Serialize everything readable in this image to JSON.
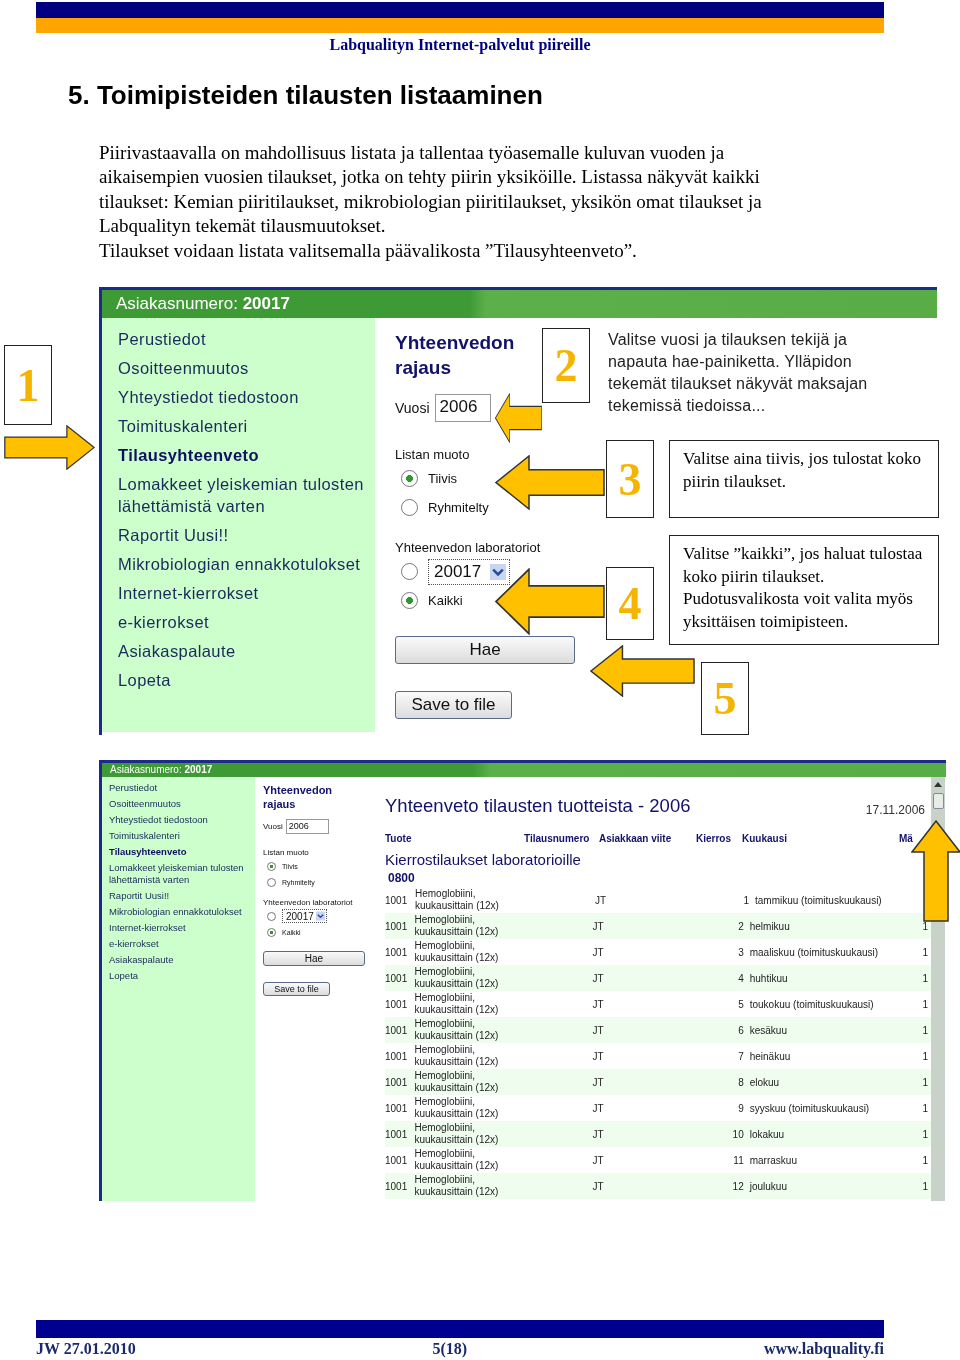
{
  "header": {
    "title": "Labqualityn Internet-palvelut piireille"
  },
  "heading": "5. Toimipisteiden tilausten listaaminen",
  "intro": [
    "Piirivastaavalla on mahdollisuus listata ja tallentaa työasemalle kuluvan vuoden ja aikaisempien vuosien tilaukset, jotka on tehty piirin yksiköille. Listassa näkyvät kaikki tilaukset: Kemian piiritilaukset, mikrobiologian piiritilaukset, yksikön omat tilaukset ja Labqualityn tekemät tilausmuutokset.",
    "Tilaukset voidaan listata valitsemalla päävalikosta ”Tilausyhteenveto”."
  ],
  "screenshot_1": {
    "customer_label": "Asiakasnumero:",
    "customer_number": "20017",
    "menu": [
      {
        "label": "Perustiedot",
        "selected": false
      },
      {
        "label": "Osoitteenmuutos",
        "selected": false
      },
      {
        "label": "Yhteystiedot tiedostoon",
        "selected": false
      },
      {
        "label": "Toimituskalenteri",
        "selected": false
      },
      {
        "label": "Tilausyhteenveto",
        "selected": true
      },
      {
        "label": "Lomakkeet yleiskemian tulosten lähettämistä varten",
        "selected": false
      },
      {
        "label": "Raportit Uusi!!",
        "selected": false
      },
      {
        "label": "Mikrobiologian ennakkotulokset",
        "selected": false
      },
      {
        "label": "Internet-kierrokset",
        "selected": false
      },
      {
        "label": "e-kierrokset",
        "selected": false
      },
      {
        "label": "Asiakaspalaute",
        "selected": false
      },
      {
        "label": "Lopeta",
        "selected": false
      }
    ],
    "panel_title": "Yhteenvedon rajaus",
    "year_label": "Vuosi",
    "year_value": "2006",
    "format_label": "Listan muoto",
    "format_options": [
      {
        "label": "Tiivis",
        "selected": true
      },
      {
        "label": "Ryhmitelty",
        "selected": false
      }
    ],
    "labs_label": "Yhteenvedon laboratoriot",
    "labs_options": [
      {
        "kind": "select",
        "value": "20017",
        "selected": false
      },
      {
        "kind": "text",
        "label": "Kaikki",
        "selected": true
      }
    ],
    "buttons": [
      "Hae",
      "Save to file"
    ]
  },
  "annotations": {
    "markers": [
      "1",
      "2",
      "3",
      "4",
      "5"
    ],
    "notes": [
      {
        "kind": "plain",
        "text": "Valitse vuosi ja tilauksen tekijä ja napauta hae-painiketta. Ylläpidon tekemät tilaukset näkyvät maksajan tekemissä tiedoissa..."
      },
      {
        "kind": "boxed",
        "text": "Valitse aina tiivis, jos tulostat koko piirin tilaukset."
      },
      {
        "kind": "boxed",
        "text": "Valitse ”kaikki”, jos haluat tulostaa koko piirin tilaukset. Pudotusvalikosta voit valita myös yksittäisen toimipisteen."
      }
    ]
  },
  "screenshot_2": {
    "customer_label": "Asiakasnumero:",
    "customer_number": "20017",
    "menu": [
      {
        "label": "Perustiedot",
        "selected": false
      },
      {
        "label": "Osoitteenmuutos",
        "selected": false
      },
      {
        "label": "Yhteystiedot tiedostoon",
        "selected": false
      },
      {
        "label": "Toimituskalenteri",
        "selected": false
      },
      {
        "label": "Tilausyhteenveto",
        "selected": true
      },
      {
        "label": "Lomakkeet yleiskemian tulosten lähettämistä varten",
        "selected": false
      },
      {
        "label": "Raportit Uusi!!",
        "selected": false
      },
      {
        "label": "Mikrobiologian ennakkotulokset",
        "selected": false
      },
      {
        "label": "Internet-kierrokset",
        "selected": false
      },
      {
        "label": "e-kierrokset",
        "selected": false
      },
      {
        "label": "Asiakaspalaute",
        "selected": false
      },
      {
        "label": "Lopeta",
        "selected": false
      }
    ],
    "panel_title": "Yhteenvedon rajaus",
    "year_label": "Vuosi",
    "year_value": "2006",
    "format_label": "Listan muoto",
    "format_options": [
      {
        "label": "Tiivis",
        "selected": true
      },
      {
        "label": "Ryhmitelty",
        "selected": false
      }
    ],
    "labs_label": "Yhteenvedon laboratoriot",
    "labs_options": [
      {
        "kind": "select",
        "value": "20017",
        "selected": false
      },
      {
        "kind": "text",
        "label": "Kaikki",
        "selected": true
      }
    ],
    "buttons": [
      "Hae",
      "Save to file"
    ],
    "report": {
      "title": "Yhteenveto tilausten tuotteista - 2006",
      "date": "17.11.2006",
      "columns": [
        "Tuote",
        "Tilausnumero",
        "Asiakkaan viite",
        "Kierros",
        "Kuukausi",
        "Mä"
      ],
      "section": "Kierrostilaukset laboratorioille",
      "group": "0800",
      "rows": [
        {
          "code": "1001",
          "product": "Hemoglobiini, kuukausittain (12x)",
          "reference": "JT",
          "round": "1",
          "month": "tammikuu (toimituskuukausi)"
        },
        {
          "code": "1001",
          "product": "Hemoglobiini, kuukausittain (12x)",
          "reference": "JT",
          "round": "2",
          "month": "helmikuu",
          "column_6": "1"
        },
        {
          "code": "1001",
          "product": "Hemoglobiini, kuukausittain (12x)",
          "reference": "JT",
          "round": "3",
          "month": "maaliskuu (toimituskuukausi)",
          "column_6": "1"
        },
        {
          "code": "1001",
          "product": "Hemoglobiini, kuukausittain (12x)",
          "reference": "JT",
          "round": "4",
          "month": "huhtikuu",
          "column_6": "1"
        },
        {
          "code": "1001",
          "product": "Hemoglobiini, kuukausittain (12x)",
          "reference": "JT",
          "round": "5",
          "month": "toukokuu (toimituskuukausi)",
          "column_6": "1"
        },
        {
          "code": "1001",
          "product": "Hemoglobiini, kuukausittain (12x)",
          "reference": "JT",
          "round": "6",
          "month": "kesäkuu",
          "column_6": "1"
        },
        {
          "code": "1001",
          "product": "Hemoglobiini, kuukausittain (12x)",
          "reference": "JT",
          "round": "7",
          "month": "heinäkuu",
          "column_6": "1"
        },
        {
          "code": "1001",
          "product": "Hemoglobiini, kuukausittain (12x)",
          "reference": "JT",
          "round": "8",
          "month": "elokuu",
          "column_6": "1"
        },
        {
          "code": "1001",
          "product": "Hemoglobiini, kuukausittain (12x)",
          "reference": "JT",
          "round": "9",
          "month": "syyskuu (toimituskuukausi)",
          "column_6": "1"
        },
        {
          "code": "1001",
          "product": "Hemoglobiini, kuukausittain (12x)",
          "reference": "JT",
          "round": "10",
          "month": "lokakuu",
          "column_6": "1"
        },
        {
          "code": "1001",
          "product": "Hemoglobiini, kuukausittain (12x)",
          "reference": "JT",
          "round": "11",
          "month": "marraskuu",
          "column_6": "1"
        },
        {
          "code": "1001",
          "product": "Hemoglobiini, kuukausittain (12x)",
          "reference": "JT",
          "round": "12",
          "month": "joulukuu",
          "column_6": "1"
        }
      ]
    }
  },
  "footer": {
    "left": "JW 27.01.2010",
    "center": "5(18)",
    "right": "www.labquality.fi"
  }
}
